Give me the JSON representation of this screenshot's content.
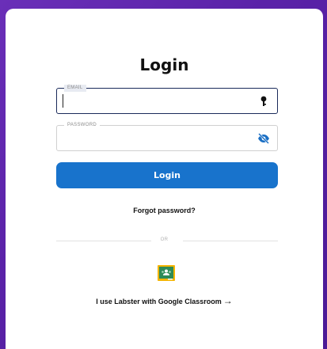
{
  "login": {
    "title": "Login",
    "email": {
      "label": "EMAIL",
      "value": "",
      "icon": "key-icon"
    },
    "password": {
      "label": "PASSWORD",
      "value": "",
      "icon": "eye-slash-icon"
    },
    "submit_label": "Login",
    "forgot_label": "Forgot password?",
    "divider_text": "OR",
    "google_classroom": {
      "icon": "google-classroom-icon",
      "label": "I use Labster with Google Classroom",
      "arrow": "→"
    }
  },
  "colors": {
    "background": "#5a22a8",
    "primary": "#1873cc",
    "focus_border": "#1a2a5a",
    "google_classroom_green": "#2e8b57",
    "google_classroom_yellow": "#f4b400"
  }
}
